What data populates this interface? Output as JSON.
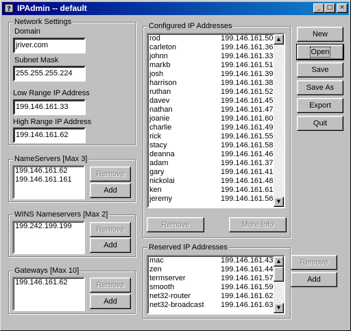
{
  "window": {
    "title": "IPAdmin -- default"
  },
  "network_settings": {
    "legend": "Network Settings",
    "domain_label": "Domain",
    "domain_value": "jriver.com",
    "subnet_label": "Subnet Mask",
    "subnet_value": "255.255.255.224",
    "low_label": "Low Range IP Address",
    "low_value": "199.146.161.33",
    "high_label": "High Range IP Address",
    "high_value": "199.146.161.62"
  },
  "nameservers": {
    "legend": "NameServers [Max 3]",
    "items": [
      "199.146.161.62",
      "199.146.161.161"
    ],
    "remove_label": "Remove",
    "add_label": "Add"
  },
  "wins": {
    "legend": "WINS Nameservers [Max 2]",
    "items": [
      "199.242.199.199"
    ],
    "remove_label": "Remove",
    "add_label": "Add"
  },
  "gateways": {
    "legend": "Gateways [Max 10]",
    "items": [
      "199.146.161.62"
    ],
    "remove_label": "Remove",
    "add_label": "Add"
  },
  "configured": {
    "legend": "Configured IP Addresses",
    "rows": [
      {
        "name": "rod",
        "ip": "199.146.161.50"
      },
      {
        "name": "carleton",
        "ip": "199.146.161.36"
      },
      {
        "name": "johnn",
        "ip": "199.146.161.33"
      },
      {
        "name": "markb",
        "ip": "199.146.161.51"
      },
      {
        "name": "josh",
        "ip": "199.146.161.39"
      },
      {
        "name": "harrison",
        "ip": "199.146.161.38"
      },
      {
        "name": "ruthan",
        "ip": "199.146.161.52"
      },
      {
        "name": "davev",
        "ip": "199.146.161.45"
      },
      {
        "name": "nathan",
        "ip": "199.146.161.47"
      },
      {
        "name": "joanie",
        "ip": "199.146.161.60"
      },
      {
        "name": "charlie",
        "ip": "199.146.161.49"
      },
      {
        "name": "rick",
        "ip": "199.146.161.55"
      },
      {
        "name": "stacy",
        "ip": "199.146.161.58"
      },
      {
        "name": "deanna",
        "ip": "199.146.161.46"
      },
      {
        "name": "adam",
        "ip": "199.146.161.37"
      },
      {
        "name": "gary",
        "ip": "199.146.161.41"
      },
      {
        "name": "nickolai",
        "ip": "199.146.161.48"
      },
      {
        "name": "ken",
        "ip": "199.146.161.61"
      },
      {
        "name": "jeremy",
        "ip": "199.146.161.56"
      }
    ],
    "remove_label": "Remove",
    "moreinfo_label": "More Info"
  },
  "reserved": {
    "legend": "Reserved IP Addresses",
    "rows": [
      {
        "name": "mac",
        "ip": "199.146.161.43"
      },
      {
        "name": "zen",
        "ip": "199.146.161.44"
      },
      {
        "name": "termserver",
        "ip": "199.146.161.57"
      },
      {
        "name": "smooth",
        "ip": "199.146.161.59"
      },
      {
        "name": "net32-router",
        "ip": "199.146.161.62"
      },
      {
        "name": "net32-broadcast",
        "ip": "199.146.161.63"
      }
    ],
    "remove_label": "Remove",
    "add_label": "Add"
  },
  "actions": {
    "new": "New",
    "open": "Open",
    "save": "Save",
    "save_as": "Save As",
    "export": "Export",
    "quit": "Quit"
  },
  "titlebar_buttons": {
    "minimize": "_",
    "maximize": "□",
    "close": "×"
  },
  "scroll_arrows": {
    "up": "▲",
    "down": "▼"
  },
  "colors": {
    "titlebar_start": "#000080",
    "titlebar_end": "#1084d0",
    "face": "#c0c0c0"
  }
}
